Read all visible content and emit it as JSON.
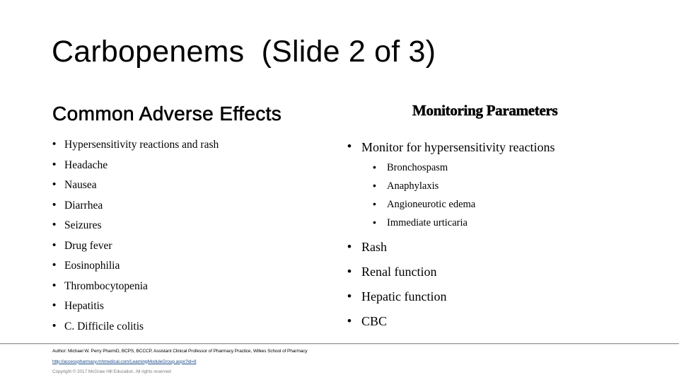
{
  "slide": {
    "title": "Carbopenems  (Slide 2 of 3)",
    "left_column": {
      "heading": "Common Adverse Effects",
      "bullet_icon": "bullet-dot",
      "items": [
        "Hypersensitivity reactions and rash",
        "Headache",
        "Nausea",
        "Diarrhea",
        "Seizures",
        "Drug fever",
        "Eosinophilia",
        "Thrombocytopenia",
        "Hepatitis",
        "C. Difficile colitis"
      ]
    },
    "right_column": {
      "heading": "Monitoring Parameters",
      "bullet_icon": "bullet-dot",
      "items_top": [
        "Monitor for hypersensitivity reactions"
      ],
      "sub_items": [
        "Bronchospasm",
        "Anaphylaxis",
        "Angioneurotic edema",
        "Immediate urticaria"
      ],
      "items_bottom": [
        "Rash",
        "Renal function",
        "Hepatic function",
        "CBC"
      ]
    },
    "footer": {
      "author": "Author: Michael W. Perry PharmD, BCPS, BCCCP, Assistant Clinical Professor of Pharmacy Practice, Wilkes School of Pharmacy",
      "url": "http://accesspharmacy.mhmedical.com/LearningModuleGroup.aspx?id=8",
      "copyright": "Copyright © 2017 McGraw Hill Education. All rights reserved"
    },
    "colors": {
      "background": "#ffffff",
      "text": "#000000",
      "link": "#1f4e8c",
      "copyright": "#7f7f7f",
      "rule": "#9a9a9a"
    }
  }
}
